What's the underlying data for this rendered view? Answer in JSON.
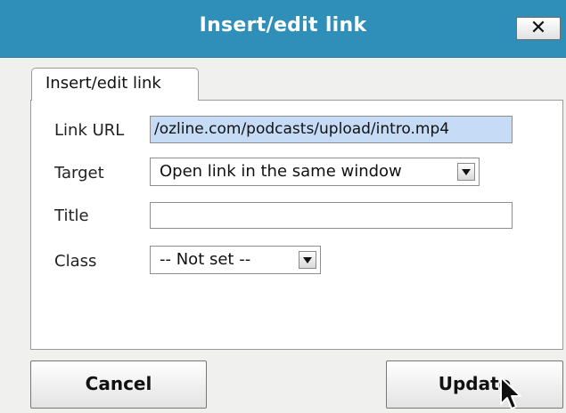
{
  "dialog": {
    "title": "Insert/edit link",
    "close_label": "✕"
  },
  "tabs": [
    {
      "label": "Insert/edit link",
      "active": true
    }
  ],
  "form": {
    "url": {
      "label": "Link URL",
      "value": "/ozline.com/podcasts/upload/intro.mp4"
    },
    "target": {
      "label": "Target",
      "value": "Open link in the same window"
    },
    "title": {
      "label": "Title",
      "value": ""
    },
    "class": {
      "label": "Class",
      "value": "-- Not set --"
    }
  },
  "buttons": {
    "cancel": "Cancel",
    "update": "Update"
  },
  "colors": {
    "titlebar": "#2f8fb8",
    "url_selection": "#c6dcf6"
  }
}
